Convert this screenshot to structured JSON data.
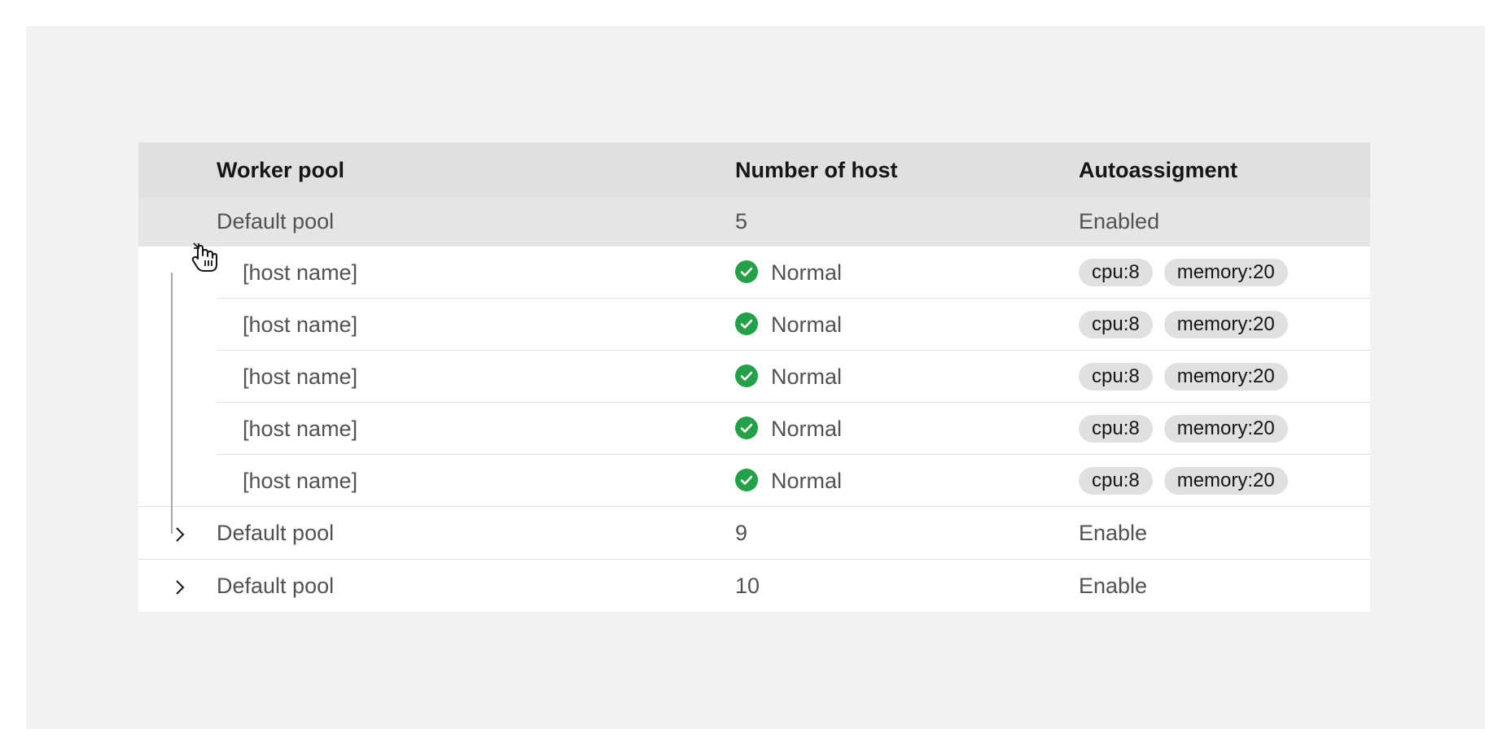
{
  "table": {
    "headers": {
      "worker_pool": "Worker pool",
      "number_of_host": "Number of host",
      "autoassignment": "Autoassigment"
    },
    "expanded_pool": {
      "name": "Default pool",
      "hosts": "5",
      "autoassign": "Enabled",
      "expand_icon": "chevron-down-icon"
    },
    "child_rows": [
      {
        "name": "[host name]",
        "status": "Normal",
        "tags": [
          "cpu:8",
          "memory:20"
        ]
      },
      {
        "name": "[host name]",
        "status": "Normal",
        "tags": [
          "cpu:8",
          "memory:20"
        ]
      },
      {
        "name": "[host name]",
        "status": "Normal",
        "tags": [
          "cpu:8",
          "memory:20"
        ]
      },
      {
        "name": "[host name]",
        "status": "Normal",
        "tags": [
          "cpu:8",
          "memory:20"
        ]
      },
      {
        "name": "[host name]",
        "status": "Normal",
        "tags": [
          "cpu:8",
          "memory:20"
        ]
      }
    ],
    "collapsed_pools": [
      {
        "name": "Default pool",
        "hosts": "9",
        "autoassign": "Enable",
        "expand_icon": "chevron-right-icon"
      },
      {
        "name": "Default pool",
        "hosts": "10",
        "autoassign": "Enable",
        "expand_icon": "chevron-right-icon"
      }
    ]
  },
  "colors": {
    "page_bg": "#f2f2f2",
    "header_bg": "#e0e0e0",
    "selected_row_bg": "#e5e5e5",
    "status_success": "#24a148",
    "tag_bg": "#e0e0e0"
  }
}
